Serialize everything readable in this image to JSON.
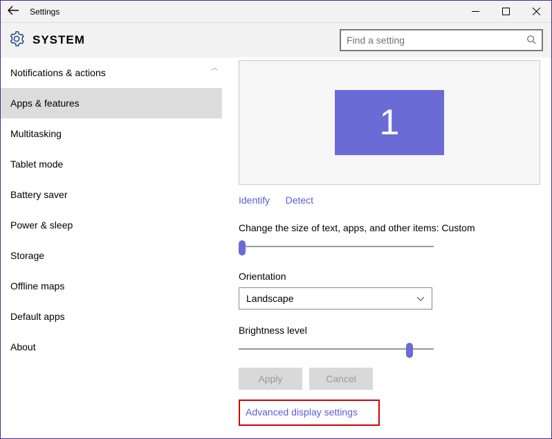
{
  "window": {
    "title": "Settings"
  },
  "header": {
    "title": "SYSTEM",
    "search_placeholder": "Find a setting"
  },
  "sidebar": {
    "items": [
      {
        "label": "Notifications & actions"
      },
      {
        "label": "Apps & features"
      },
      {
        "label": "Multitasking"
      },
      {
        "label": "Tablet mode"
      },
      {
        "label": "Battery saver"
      },
      {
        "label": "Power & sleep"
      },
      {
        "label": "Storage"
      },
      {
        "label": "Offline maps"
      },
      {
        "label": "Default apps"
      },
      {
        "label": "About"
      }
    ]
  },
  "display": {
    "monitor_number": "1",
    "identify": "Identify",
    "detect": "Detect",
    "size_label": "Change the size of text, apps, and other items: Custom",
    "orientation_label": "Orientation",
    "orientation_value": "Landscape",
    "brightness_label": "Brightness level",
    "apply": "Apply",
    "cancel": "Cancel",
    "advanced": "Advanced display settings"
  }
}
